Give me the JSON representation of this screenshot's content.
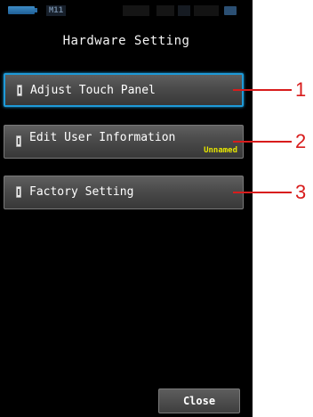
{
  "status_bar": {
    "mode_label": "M11"
  },
  "header": {
    "title": "Hardware Setting"
  },
  "menu": {
    "items": [
      {
        "label": "Adjust Touch Panel",
        "selected": true
      },
      {
        "label": "Edit User Information",
        "sub_label": "Unnamed"
      },
      {
        "label": "Factory Setting"
      }
    ]
  },
  "footer": {
    "close_label": "Close"
  },
  "callouts": {
    "labels": [
      "1",
      "2",
      "3"
    ],
    "color": "#d81c1c"
  },
  "colors": {
    "screen_background": "#000000",
    "selection_border": "#1e9ad8",
    "sub_label": "#e6e600"
  }
}
